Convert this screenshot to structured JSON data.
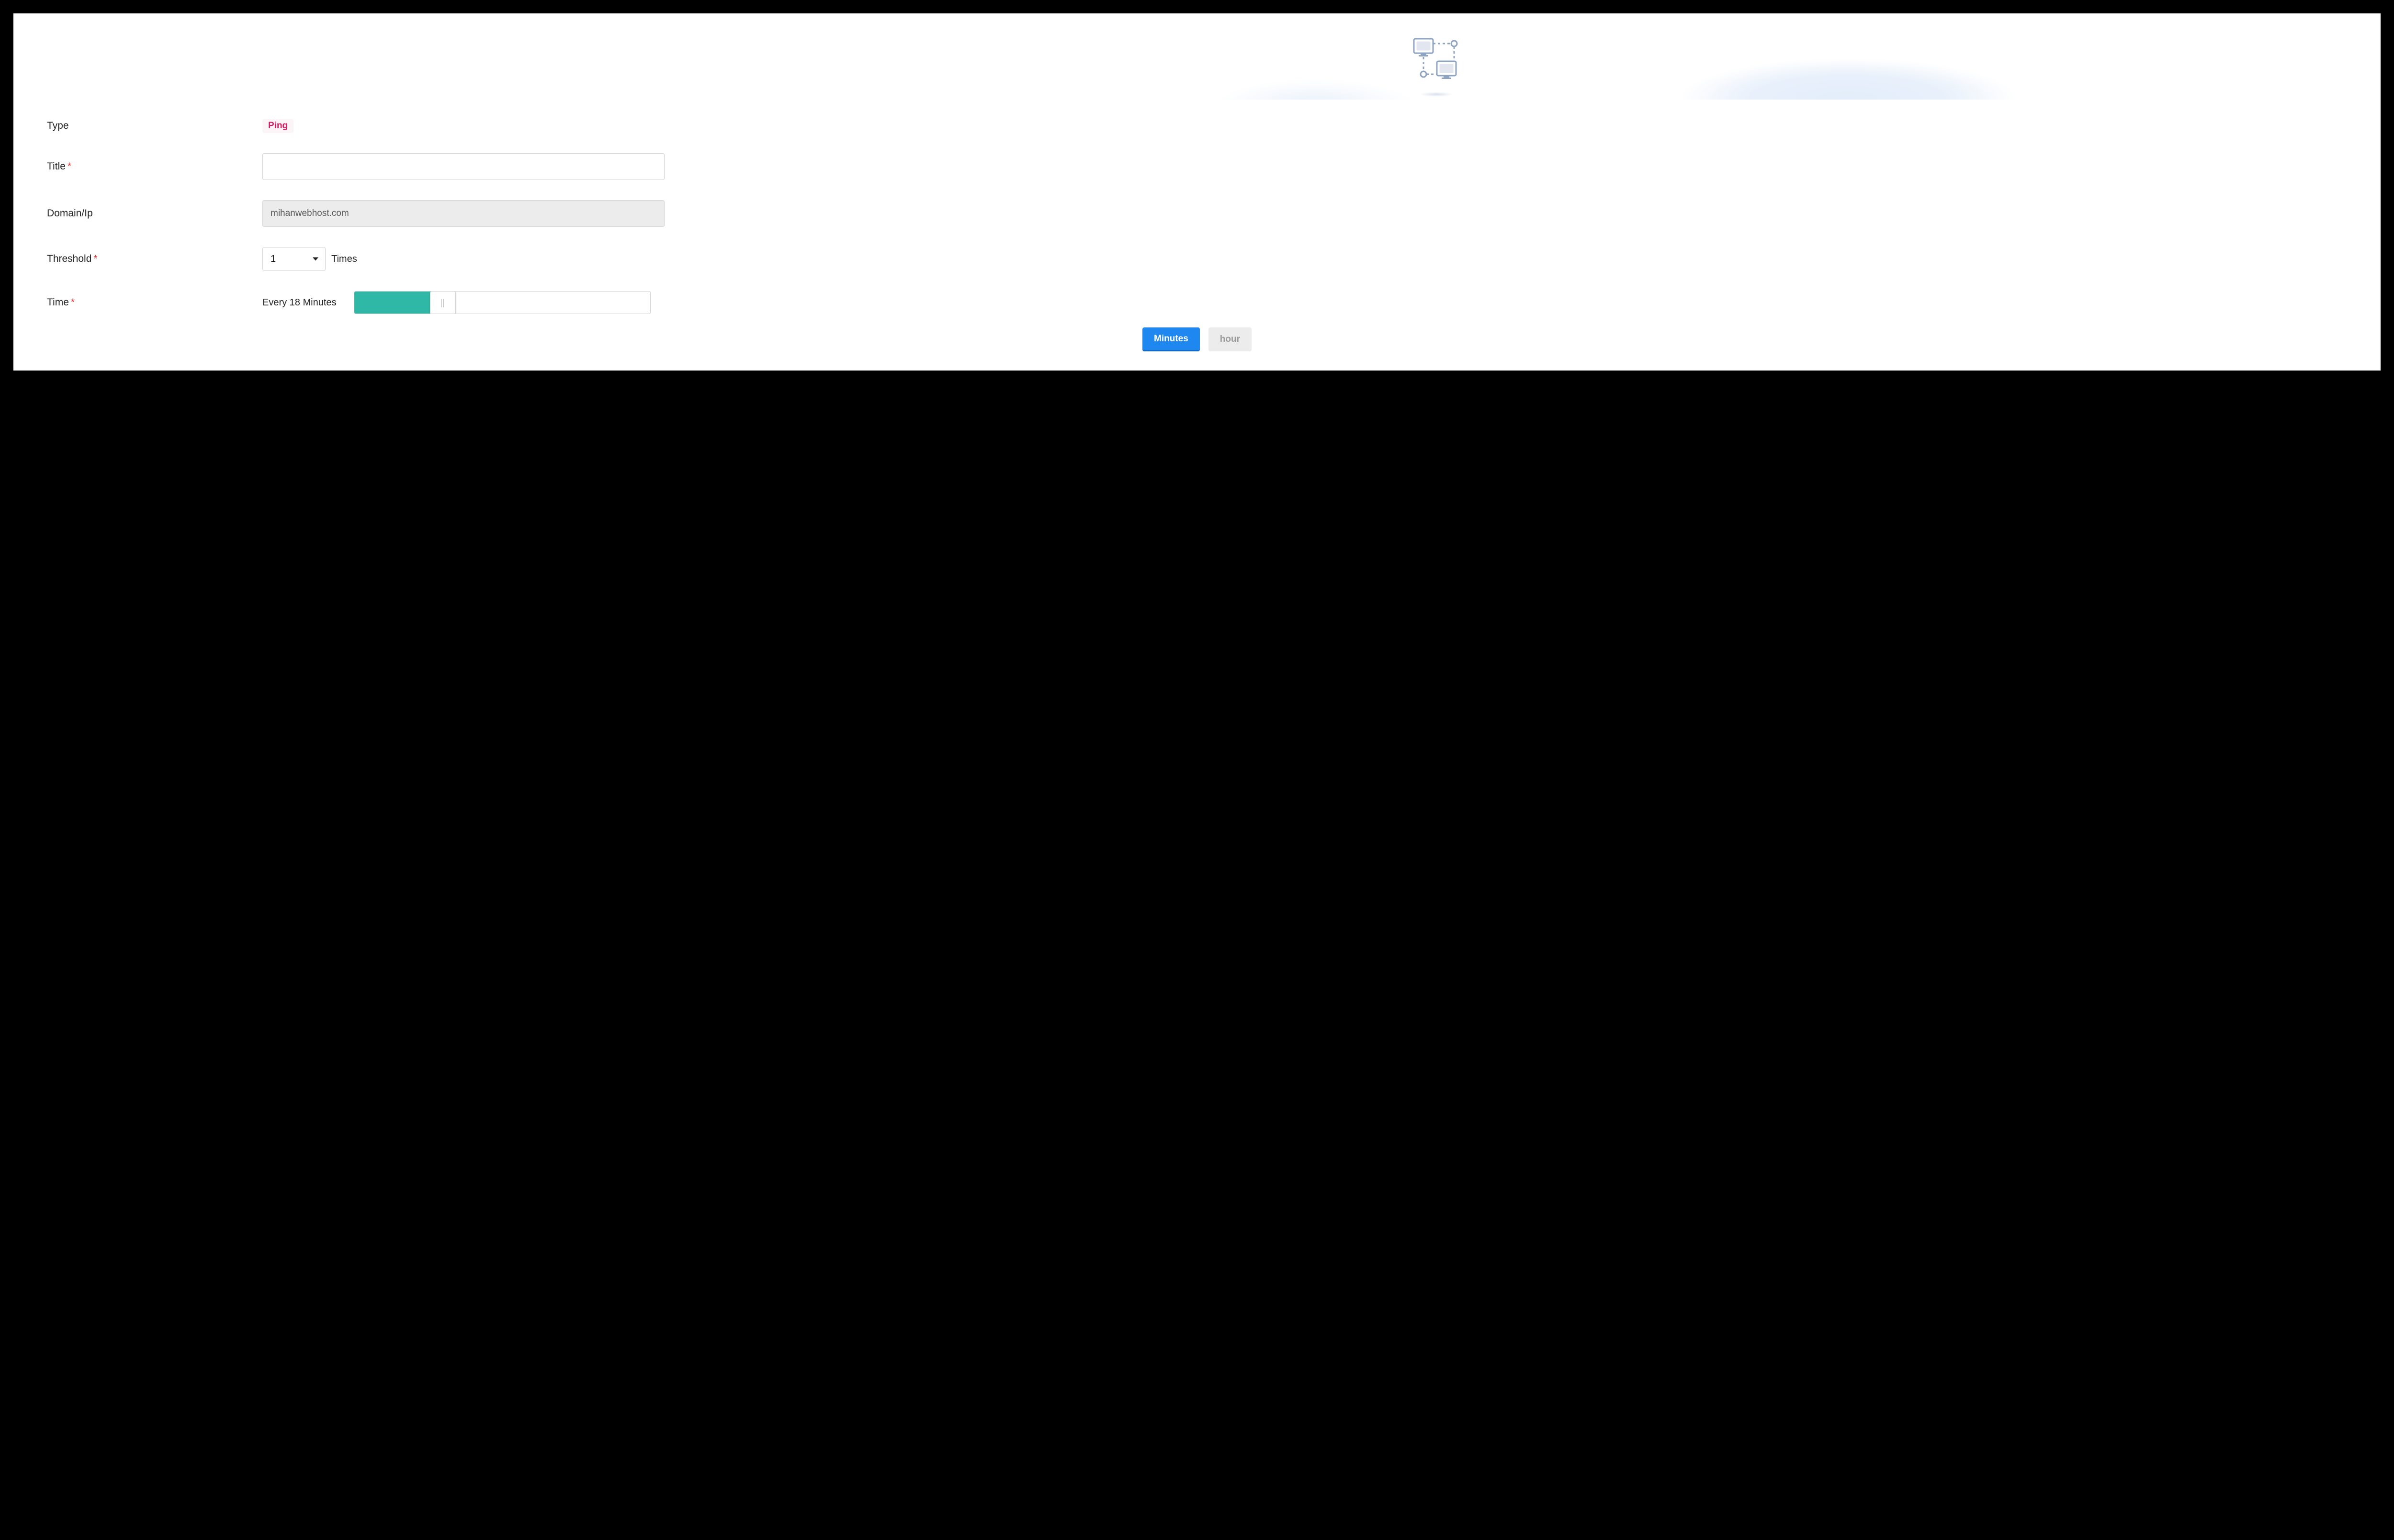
{
  "form": {
    "type_label": "Type",
    "type_value": "Ping",
    "title_label": "Title",
    "title_value": "",
    "title_placeholder": "",
    "domain_label": "Domain/Ip",
    "domain_value": "mihanwebhost.com",
    "threshold_label": "Threshold",
    "threshold_value": "1",
    "threshold_unit": "Times",
    "time_label": "Time",
    "time_text": "Every 18 Minutes",
    "slider_percent": 30,
    "unit_minutes": "Minutes",
    "unit_hour": "hour"
  }
}
